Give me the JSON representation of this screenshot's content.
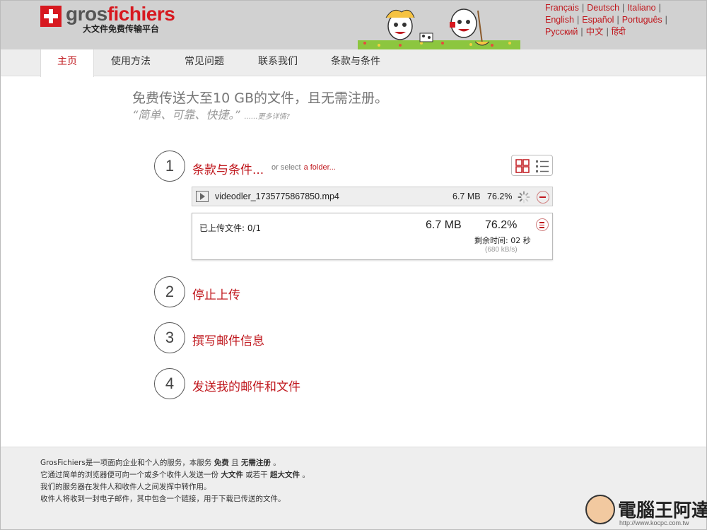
{
  "header": {
    "brand_gros": "gros",
    "brand_fichiers": "fichiers",
    "tagline": "大文件免费传输平台",
    "languages": [
      [
        "Français",
        "Deutsch",
        "Italiano"
      ],
      [
        "English",
        "Español",
        "Português"
      ],
      [
        "Русский",
        "中文",
        "हिंदी"
      ]
    ]
  },
  "nav": {
    "items": [
      "主页",
      "使用方法",
      "常见问题",
      "联系我们",
      "条款与条件"
    ],
    "active_index": 0
  },
  "hero": {
    "title": "免费传送大至10 GB的文件，且无需注册。",
    "subtitle": "“简单、可靠、快捷。”",
    "more": "......更多详情?"
  },
  "steps": [
    {
      "number": "1",
      "label": "条款与条件..."
    },
    {
      "number": "2",
      "label": "停止上传"
    },
    {
      "number": "3",
      "label": "撰写邮件信息"
    },
    {
      "number": "4",
      "label": "发送我的邮件和文件"
    }
  ],
  "or_select": {
    "text": "or select",
    "link": "a folder..."
  },
  "file": {
    "name": "videodler_1735775867850.mp4",
    "size": "6.7 MB",
    "percent": "76.2%"
  },
  "progress": {
    "files_uploaded": "已上传文件: 0/1",
    "size": "6.7 MB",
    "percent": "76.2%",
    "remaining": "剩余时间: 02 秒",
    "speed": "(680 kB/s)"
  },
  "footer": {
    "line1_a": "GrosFichiers是一项面向企业和个人的服务，本服务",
    "line1_b": "免费",
    "line1_c": "且",
    "line1_d": "无需注册",
    "line1_e": "。",
    "line2_a": "它通过简单的浏览器便可向一个或多个收件人发送一份",
    "line2_b": "大文件",
    "line2_c": "或若干",
    "line2_d": "超大文件",
    "line2_e": "。",
    "line3": "我们的服务器在发件人和收件人之间发挥中转作用。",
    "line4": "收件人将收到一封电子邮件，其中包含一个链接，用于下载已传送的文件。"
  },
  "watermark": {
    "text": "電腦王阿達",
    "url": "http://www.kocpc.com.tw"
  },
  "colors": {
    "accent": "#c0181e",
    "header_bg": "#d1d1d1",
    "nav_bg": "#ededed",
    "footer_bg": "#eeeeee"
  }
}
